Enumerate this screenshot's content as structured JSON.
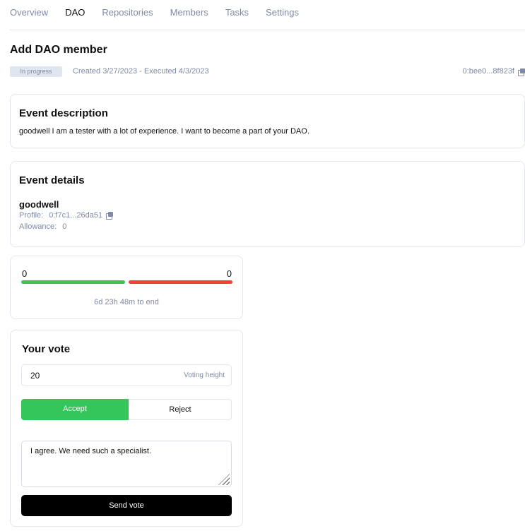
{
  "tabs": [
    {
      "label": "Overview"
    },
    {
      "label": "DAO"
    },
    {
      "label": "Repositories"
    },
    {
      "label": "Members"
    },
    {
      "label": "Tasks"
    },
    {
      "label": "Settings"
    }
  ],
  "active_tab": "DAO",
  "event": {
    "title": "Add DAO member",
    "status": "In progress",
    "dates": "Created 3/27/2023 - Executed 4/3/2023",
    "address": "0:bee0...8f823f"
  },
  "description": {
    "title": "Event description",
    "text": "goodwell I am a tester with a lot of experience. I want to become a part of your DAO."
  },
  "details": {
    "title": "Event details",
    "member_name": "goodwell",
    "profile_label": "Profile:",
    "profile_value": "0:f7c1...26da51",
    "allowance_label": "Allowance:",
    "allowance_value": "0"
  },
  "results": {
    "accept_count": "0",
    "reject_count": "0",
    "time_left": "6d 23h 48m to end"
  },
  "vote": {
    "title": "Your vote",
    "voting_height": "20",
    "voting_height_hint": "Voting height",
    "accept_label": "Accept",
    "reject_label": "Reject",
    "selected": "Accept",
    "comment": "I agree. We need such a specialist.",
    "send_label": "Send vote"
  },
  "colors": {
    "accent_green": "#35c65b",
    "reject_red": "#f0433a",
    "muted_text": "#7f8aa6",
    "border": "#e3e6ec"
  }
}
